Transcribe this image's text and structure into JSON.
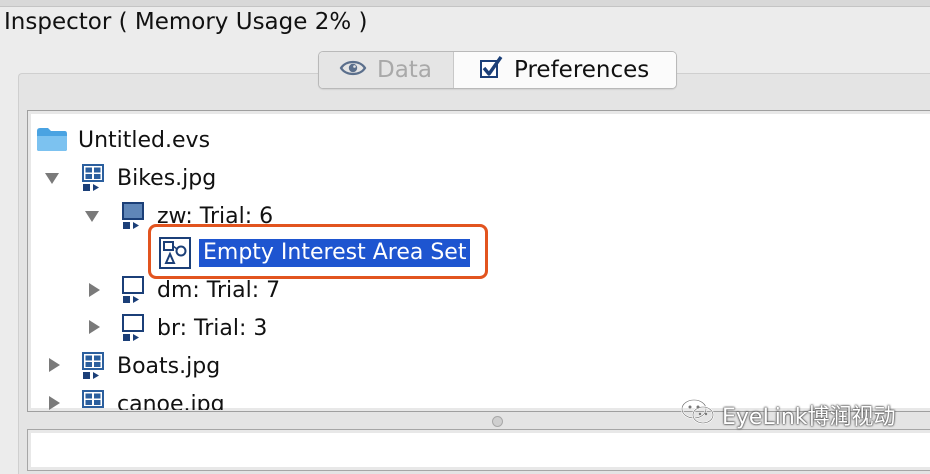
{
  "window": {
    "title": "Inspector ( Memory Usage 2% )"
  },
  "tabs": [
    {
      "label": "Data",
      "icon": "eye-icon",
      "active": false
    },
    {
      "label": "Preferences",
      "icon": "checkbox-icon",
      "active": true
    }
  ],
  "tree": {
    "root": {
      "label": "Untitled.evs",
      "icon": "folder-icon"
    },
    "items": [
      {
        "label": "Bikes.jpg",
        "icon": "image-node-icon",
        "expanded": true
      },
      {
        "label": "zw: Trial: 6",
        "icon": "trial-icon",
        "expanded": true
      },
      {
        "label": "Empty Interest Area Set",
        "icon": "interest-area-icon",
        "selected": true
      },
      {
        "label": "dm: Trial: 7",
        "icon": "trial-icon",
        "expanded": false
      },
      {
        "label": "br: Trial: 3",
        "icon": "trial-icon",
        "expanded": false
      },
      {
        "label": "Boats.jpg",
        "icon": "image-node-icon",
        "expanded": false
      },
      {
        "label": "canoe.jpg",
        "icon": "image-node-icon",
        "expanded": false
      }
    ]
  },
  "watermark": {
    "text": "EyeLink博润视动",
    "icon": "wechat-icon"
  },
  "colors": {
    "selection": "#1e55d0",
    "highlight_border": "#e2541f",
    "node_icon": "#2b5f9e",
    "folder": "#5aaee8"
  }
}
